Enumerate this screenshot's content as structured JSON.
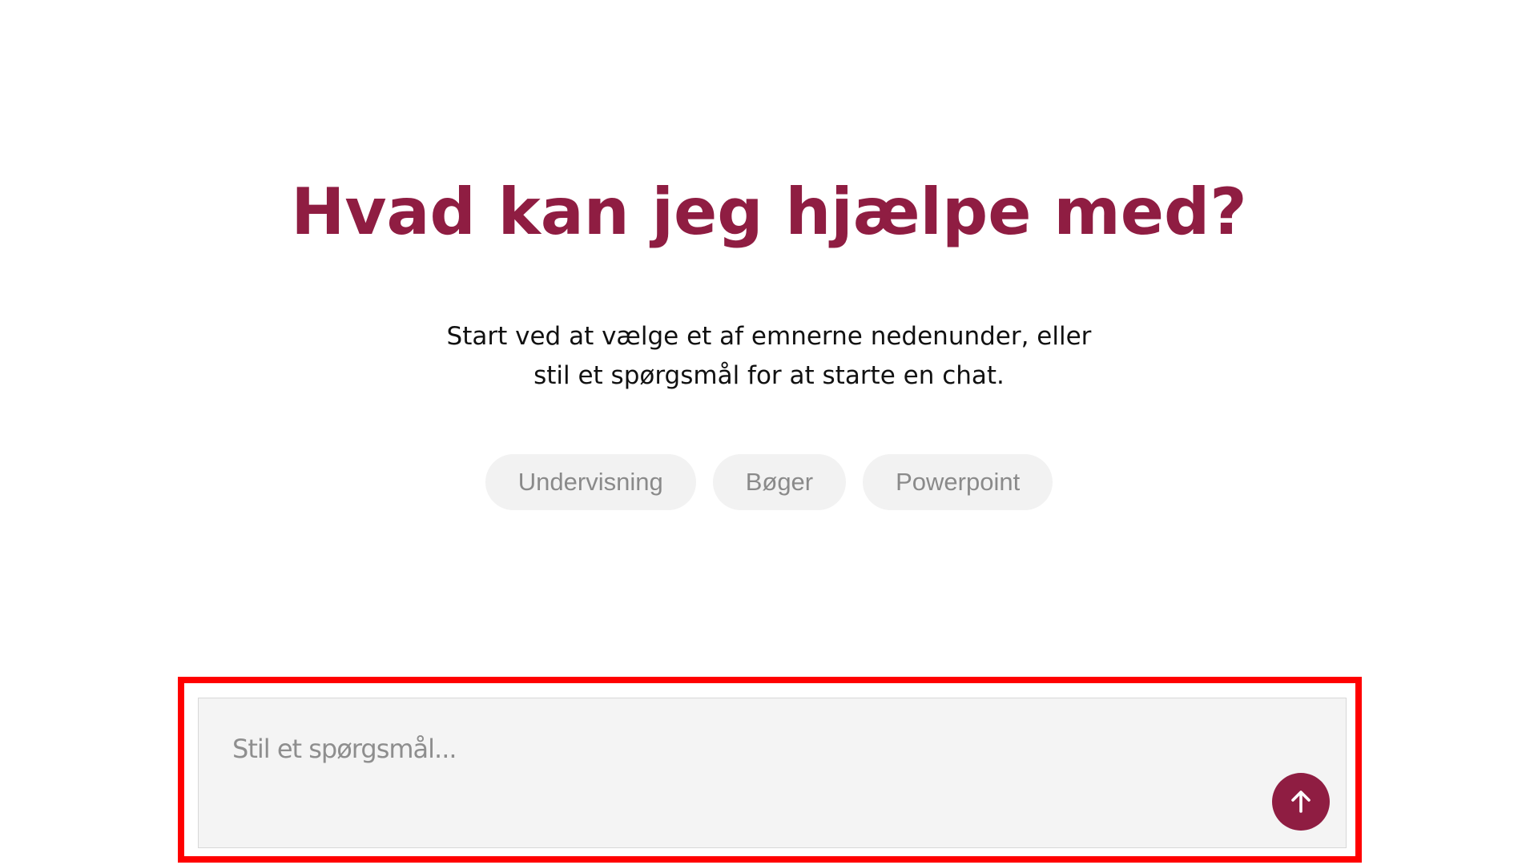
{
  "main": {
    "heading": "Hvad kan jeg hjælpe med?",
    "subtitle_line1": "Start ved at vælge et af emnerne nedenunder, eller",
    "subtitle_line2": "stil et spørgsmål for at starte en chat.",
    "topics": [
      {
        "label": "Undervisning"
      },
      {
        "label": "Bøger"
      },
      {
        "label": "Powerpoint"
      }
    ]
  },
  "chat_input": {
    "placeholder": "Stil et spørgsmål...",
    "value": "",
    "send_icon": "arrow-up-icon"
  },
  "colors": {
    "accent": "#8f1d42",
    "chip_background": "#f2f2f2",
    "chip_text": "#8a8a8a",
    "input_background": "#f4f4f4",
    "highlight_border": "#ff0000"
  }
}
